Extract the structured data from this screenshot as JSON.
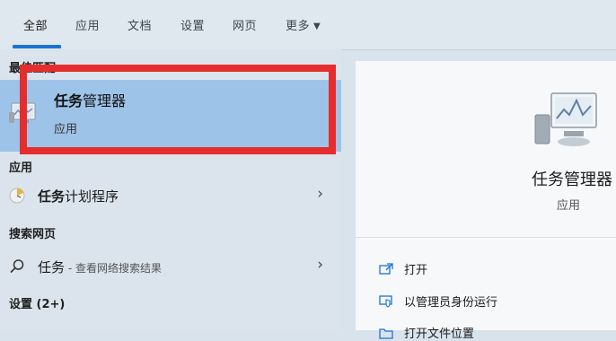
{
  "tabs": [
    {
      "label": "全部"
    },
    {
      "label": "应用"
    },
    {
      "label": "文档"
    },
    {
      "label": "设置"
    },
    {
      "label": "网页"
    },
    {
      "label": "更多"
    }
  ],
  "sections": {
    "best_match": "最佳匹配",
    "apps": "应用",
    "web": "搜索网页",
    "settings": "设置 (2+)"
  },
  "best_match": {
    "title_bold": "任务",
    "title_rest": "管理器",
    "subtitle": "应用"
  },
  "results": [
    {
      "bold": "任务",
      "rest": "计划程序",
      "icon": "task-scheduler-icon"
    },
    {
      "bold": "任务",
      "rest": "",
      "desc": " - 查看网络搜索结果",
      "icon": "search-icon"
    }
  ],
  "details": {
    "name": "任务管理器",
    "kind": "应用",
    "actions": [
      {
        "label": "打开",
        "icon": "open-icon"
      },
      {
        "label": "以管理员身份运行",
        "icon": "shield-admin-icon"
      },
      {
        "label": "打开文件位置",
        "icon": "folder-icon"
      }
    ]
  },
  "colors": {
    "selection": "#9ec3e8",
    "highlight_box": "#e52d2d",
    "accent": "#1a73d6"
  }
}
